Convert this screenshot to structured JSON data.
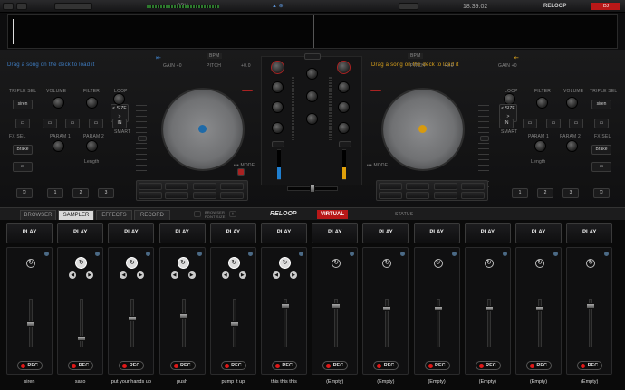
{
  "topbar": {
    "cpu_label": "CPU",
    "clock": "18:39:02",
    "brand": "RELOOP"
  },
  "deckA": {
    "drag_text": "Drag a song on the deck to load it",
    "gain": "GAIN +0",
    "pitch_label": "PITCH",
    "pitch_value": "+0.0",
    "bpm": "BPM",
    "jog_center_color": "#1e6aa8",
    "fx_labels": [
      "TRIPLE SEL",
      "VOLUME",
      "FILTER",
      "LOOP"
    ],
    "fx_sel": "FX SEL",
    "param": "PARAM 2",
    "param1": "PARAM 1",
    "fx1": "siren",
    "fx2": "Brake",
    "length": "Length",
    "size": "< SIZE >",
    "smart": "SMART",
    "cue_labels": [
      "1",
      "2",
      "3"
    ]
  },
  "deckB": {
    "drag_text": "Drag a song on the deck to load it",
    "gain": "GAIN +0",
    "pitch_label": "PITCH",
    "pitch_value": "+0.0",
    "bpm": "BPM",
    "jog_center_color": "#d79a0e",
    "fx1": "siren",
    "fx2": "Brake",
    "length": "Length",
    "size": "< SIZE >",
    "smart": "SMART",
    "cue_labels": [
      "1",
      "2",
      "3"
    ]
  },
  "tabs": [
    {
      "label": "BROWSER",
      "active": false
    },
    {
      "label": "SAMPLER",
      "active": true
    },
    {
      "label": "EFFECTS",
      "active": false
    },
    {
      "label": "RECORD",
      "active": false
    }
  ],
  "browser_font": "BROWSER FONT SIZE",
  "status": "STATUS",
  "brand2": "RELOOP",
  "brand3": "VIRTUAL DJ",
  "sampler": {
    "play_label": "PLAY",
    "rec_label": "REC",
    "slots": [
      {
        "name": "siren",
        "loaded": false,
        "fader": 0.45
      },
      {
        "name": "saxo",
        "loaded": true,
        "fader": 0.1
      },
      {
        "name": "put your hands up",
        "loaded": true,
        "fader": 0.6
      },
      {
        "name": "push",
        "loaded": true,
        "fader": 0.65
      },
      {
        "name": "pump it up",
        "loaded": true,
        "fader": 0.45
      },
      {
        "name": "this this this",
        "loaded": true,
        "fader": 0.9
      },
      {
        "name": "(Empty)",
        "loaded": false,
        "fader": 0.9
      },
      {
        "name": "(Empty)",
        "loaded": false,
        "fader": 0.85
      },
      {
        "name": "(Empty)",
        "loaded": false,
        "fader": 0.85
      },
      {
        "name": "(Empty)",
        "loaded": false,
        "fader": 0.85
      },
      {
        "name": "(Empty)",
        "loaded": false,
        "fader": 0.85
      },
      {
        "name": "(Empty)",
        "loaded": false,
        "fader": 0.9
      }
    ]
  }
}
